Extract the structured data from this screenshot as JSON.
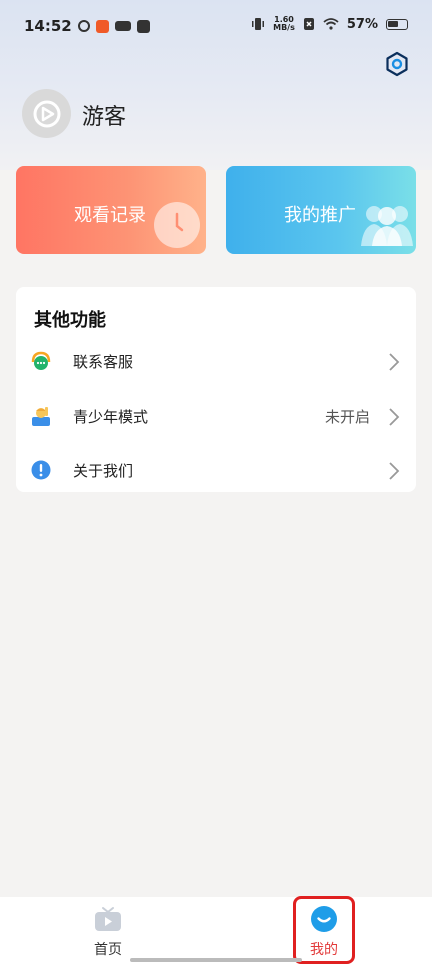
{
  "status_bar": {
    "time": "14:52",
    "net_speed_value": "1.60",
    "net_speed_unit": "MB/s",
    "battery": "57%"
  },
  "profile": {
    "username": "游客"
  },
  "cards": {
    "history_label": "观看记录",
    "promo_label": "我的推广"
  },
  "other_functions": {
    "title": "其他功能",
    "items": [
      {
        "label": "联系客服",
        "value": "",
        "icon": "headset-icon"
      },
      {
        "label": "青少年模式",
        "value": "未开启",
        "icon": "teen-icon"
      },
      {
        "label": "关于我们",
        "value": "",
        "icon": "info-icon"
      }
    ]
  },
  "tabbar": {
    "home_label": "首页",
    "mine_label": "我的",
    "active": "mine"
  },
  "colors": {
    "accent_red": "#e02020",
    "history_card": "#ff7563",
    "promo_card": "#3fb0ec",
    "mine_tab_icon": "#1f9de8"
  }
}
